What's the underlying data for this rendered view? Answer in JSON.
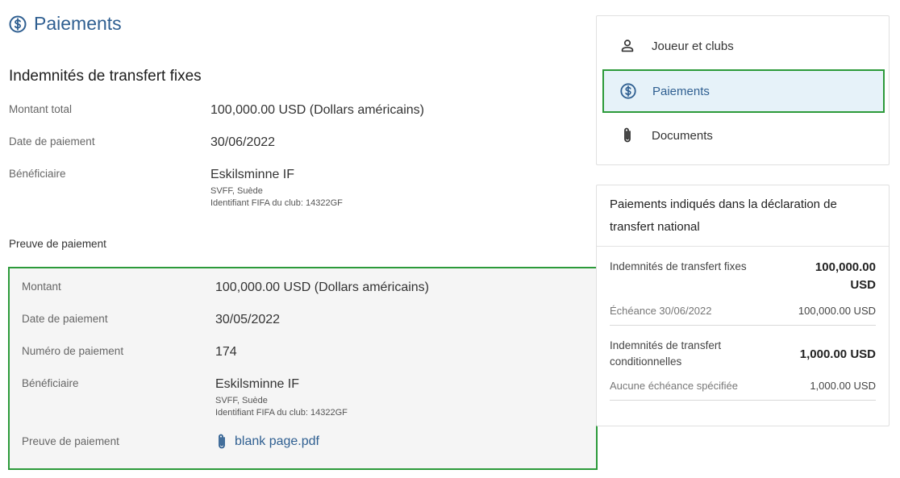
{
  "page": {
    "title": "Paiements",
    "title_icon": "dollar-circle-icon"
  },
  "fixed_fees": {
    "heading": "Indemnités de transfert fixes",
    "rows": {
      "total": {
        "label": "Montant total",
        "value": "100,000.00 USD (Dollars américains)"
      },
      "date": {
        "label": "Date de paiement",
        "value": "30/06/2022"
      },
      "beneficiary": {
        "label": "Bénéficiaire",
        "value": "Eskilsminne IF",
        "sub1": "SVFF, Suède",
        "sub2": "Identifiant FIFA du club: 14322GF"
      }
    }
  },
  "proof": {
    "heading": "Preuve de paiement",
    "rows": {
      "amount": {
        "label": "Montant",
        "value": "100,000.00 USD (Dollars américains)"
      },
      "date": {
        "label": "Date de paiement",
        "value": "30/05/2022"
      },
      "number": {
        "label": "Numéro de paiement",
        "value": "174"
      },
      "beneficiary": {
        "label": "Bénéficiaire",
        "value": "Eskilsminne IF",
        "sub1": "SVFF, Suède",
        "sub2": "Identifiant FIFA du club: 14322GF"
      },
      "file": {
        "label": "Preuve de paiement",
        "value": "blank page.pdf",
        "icon": "paperclip-icon"
      }
    }
  },
  "nav": {
    "items": [
      {
        "label": "Joueur et clubs",
        "icon": "person-icon",
        "active": false
      },
      {
        "label": "Paiements",
        "icon": "dollar-circle-icon",
        "active": true
      },
      {
        "label": "Documents",
        "icon": "paperclip-icon",
        "active": false
      }
    ]
  },
  "summary": {
    "title": "Paiements indiqués dans la déclaration de transfert national",
    "blocks": [
      {
        "name": "Indemnités de transfert fixes",
        "amount_line1": "100,000.00",
        "amount_line2": "USD",
        "sub_label": "Échéance 30/06/2022",
        "sub_amount": "100,000.00 USD"
      },
      {
        "name": "Indemnités de transfert conditionnelles",
        "amount_line1": "1,000.00 USD",
        "amount_line2": "",
        "sub_label": "Aucune échéance spécifiée",
        "sub_amount": "1,000.00 USD"
      }
    ]
  },
  "colors": {
    "accent": "#2f5f91",
    "highlight_border": "#2c9a3a",
    "active_bg": "#e6f2f9",
    "proof_bg": "#f5f5f5"
  }
}
